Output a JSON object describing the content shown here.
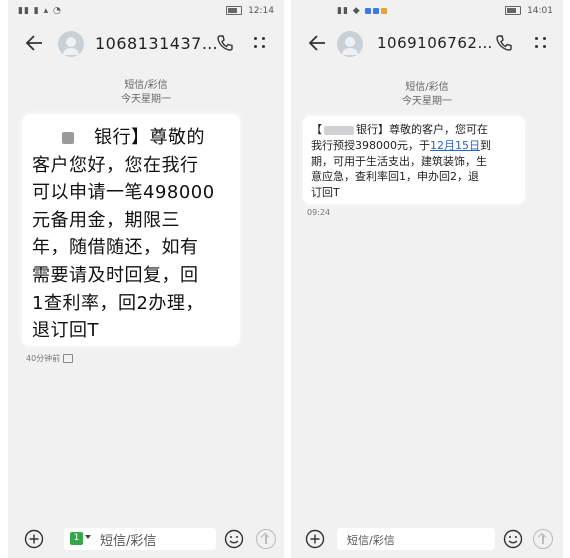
{
  "left": {
    "status": {
      "time": "12:14"
    },
    "header": {
      "number": "1068131437…"
    },
    "conversation": {
      "type_label": "短信/彩信",
      "date_label": "今天星期一"
    },
    "message": {
      "lines": [
        "银行】尊敬的",
        "客户您好，您在我行",
        "可以申请一笔498000",
        "元备用金，期限三",
        "年，随借随还，如有",
        "需要请及时回复，回",
        "1查利率，回2办理，",
        "退订回T"
      ],
      "time": "40分钟前"
    },
    "composer": {
      "placeholder": "短信/彩信",
      "sim": "1"
    }
  },
  "right": {
    "status": {
      "time": "14:01"
    },
    "header": {
      "number": "1069106762…"
    },
    "conversation": {
      "type_label": "短信/彩信",
      "date_label": "今天星期一"
    },
    "message": {
      "line1": "【",
      "line1b": "银行】尊敬的客户，您可在",
      "line2a": "我行预授398000元，于",
      "line2link": "12月15日",
      "line2b": "到",
      "line3": "期，可用于生活支出，建筑装饰，生",
      "line4": "意应急，查利率回1，申办回2，退",
      "line5": "订回T",
      "time": "09:24"
    },
    "composer": {
      "placeholder": "短信/彩信"
    }
  }
}
